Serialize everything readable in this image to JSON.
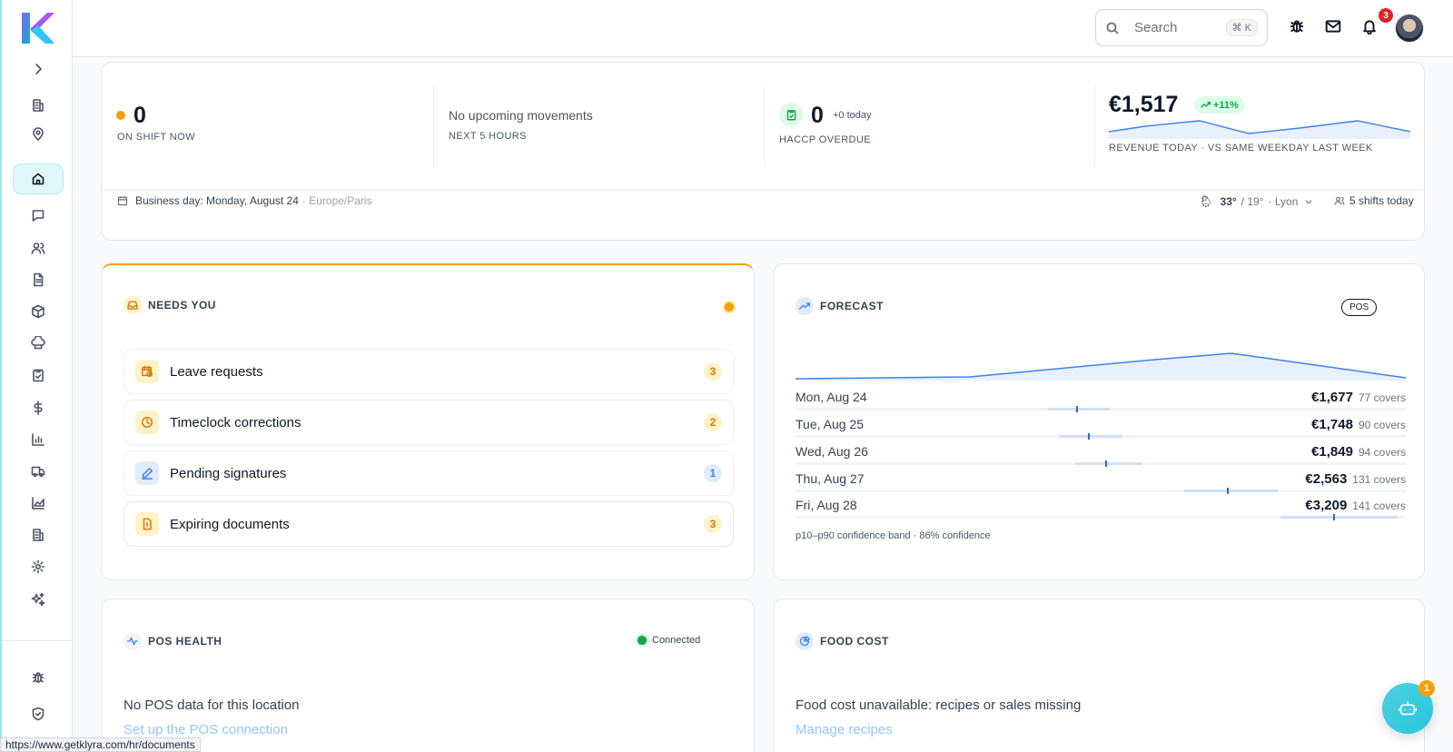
{
  "colors": {
    "accent": "#26c6da",
    "orange": "#f59e0b",
    "blue": "#3b82f6",
    "green": "#16a34a",
    "red": "#dc2626"
  },
  "topbar": {
    "search_label": "Search",
    "search_shortcut": "⌘ K",
    "notifications_count": "3"
  },
  "stats": {
    "on_shift_value": "0",
    "on_shift_label": "ON SHIFT NOW",
    "movements_title": "No upcoming movements",
    "movements_label": "NEXT 5 HOURS",
    "haccp_value": "0",
    "haccp_today": "+0 today",
    "haccp_label": "HACCP OVERDUE",
    "revenue_value": "€1,517",
    "revenue_change": "+11%",
    "revenue_label": "REVENUE TODAY · VS SAME WEEKDAY LAST WEEK",
    "business_day": "Business day: Monday, August 24",
    "timezone": "· Europe/Paris",
    "weather_high": "33°",
    "weather_low": "/ 19°",
    "city": "· Lyon",
    "shifts_today": "5 shifts today"
  },
  "needs_you": {
    "title": "NEEDS YOU",
    "items": [
      {
        "label": "Leave requests",
        "count": "3"
      },
      {
        "label": "Timeclock corrections",
        "count": "2"
      },
      {
        "label": "Pending signatures",
        "count": "1"
      },
      {
        "label": "Expiring documents",
        "count": "3"
      }
    ]
  },
  "forecast": {
    "title": "FORECAST",
    "badge": "POS",
    "rows": [
      {
        "day": "Mon, Aug 24",
        "value": "€1,677",
        "covers": "77 covers"
      },
      {
        "day": "Tue, Aug 25",
        "value": "€1,748",
        "covers": "90 covers"
      },
      {
        "day": "Wed, Aug 26",
        "value": "€1,849",
        "covers": "94 covers"
      },
      {
        "day": "Thu, Aug 27",
        "value": "€2,563",
        "covers": "131 covers"
      },
      {
        "day": "Fri, Aug 28",
        "value": "€3,209",
        "covers": "141 covers"
      }
    ],
    "footnote": "p10–p90 confidence band · 86% confidence"
  },
  "pos_health": {
    "title": "POS HEALTH",
    "status": "Connected",
    "message": "No POS data for this location",
    "link": "Set up the POS connection"
  },
  "food_cost": {
    "title": "FOOD COST",
    "message": "Food cost unavailable: recipes or sales missing",
    "link": "Manage recipes"
  },
  "chatbot_badge": "1",
  "status_url": "https://www.getklyra.com/hr/documents"
}
